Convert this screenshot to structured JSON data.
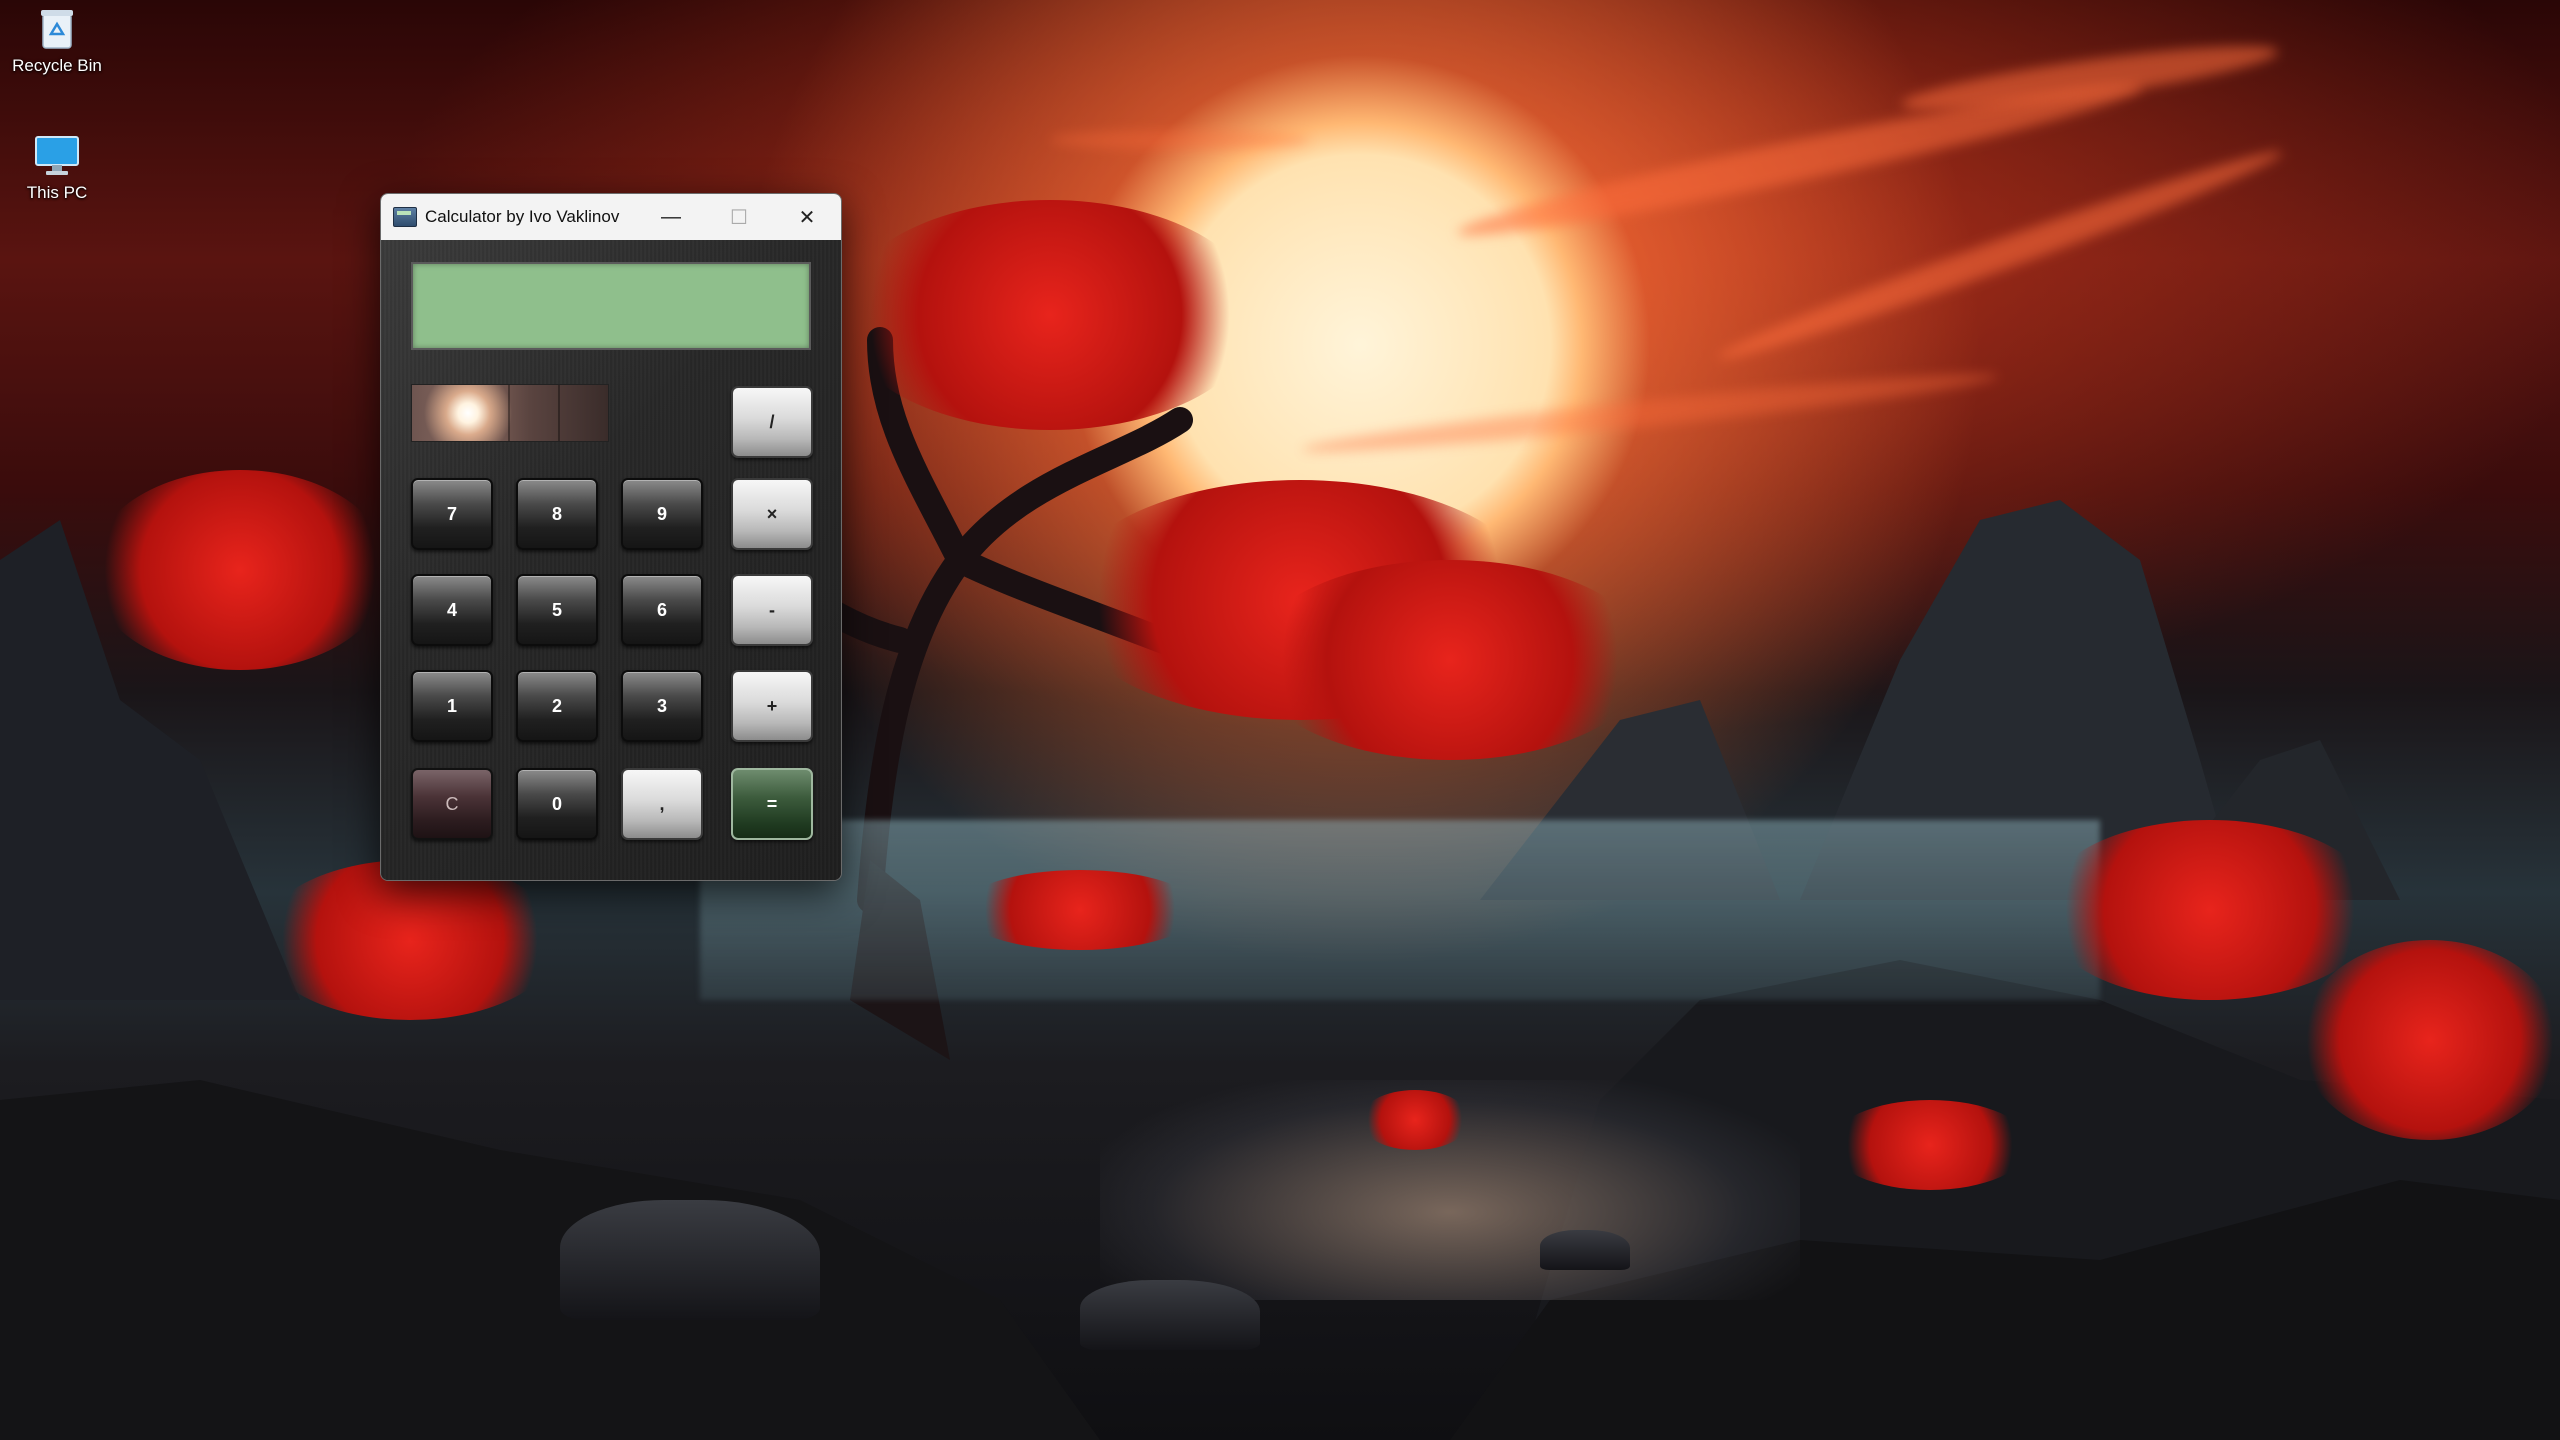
{
  "desktop": {
    "icons": [
      {
        "label": "Recycle Bin",
        "icon": "recycle-bin-icon"
      },
      {
        "label": "This PC",
        "icon": "monitor-icon"
      }
    ]
  },
  "calculator": {
    "window_title": "Calculator by Ivo Vaklinov",
    "controls": {
      "minimize": "—",
      "maximize": "☐",
      "close": "✕"
    },
    "display_value": "",
    "keys": {
      "divide": "/",
      "multiply": "×",
      "minus": "-",
      "plus": "+",
      "seven": "7",
      "eight": "8",
      "nine": "9",
      "four": "4",
      "five": "5",
      "six": "6",
      "one": "1",
      "two": "2",
      "three": "3",
      "clear": "C",
      "zero": "0",
      "decimal": ",",
      "equals": "="
    },
    "colors": {
      "display": "#8fbf8c",
      "equals_key": "#3d5c3d",
      "clear_key": "#4a3236"
    }
  }
}
